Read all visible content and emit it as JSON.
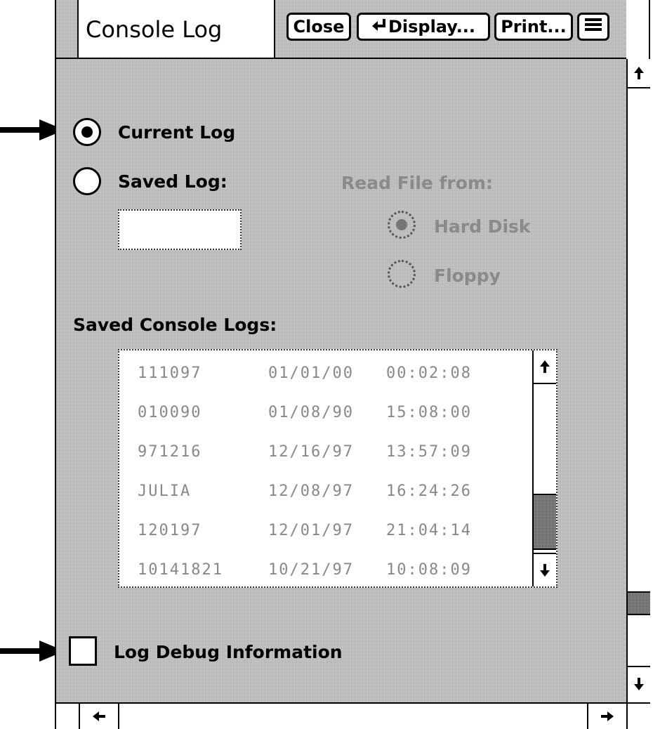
{
  "window": {
    "title": "Console Log",
    "buttons": {
      "close": "Close",
      "display": "Display...",
      "print": "Print..."
    }
  },
  "log_source": {
    "current_label": "Current Log",
    "current_selected": true,
    "saved_label": "Saved Log:",
    "saved_selected": false,
    "saved_name_value": ""
  },
  "read_from": {
    "label": "Read File from:",
    "options": [
      {
        "label": "Hard Disk",
        "selected": true
      },
      {
        "label": "Floppy",
        "selected": false
      }
    ]
  },
  "saved_logs": {
    "label": "Saved Console Logs:",
    "rows": [
      {
        "name": "111097",
        "date": "01/01/00",
        "time": "00:02:08"
      },
      {
        "name": "010090",
        "date": "01/08/90",
        "time": "15:08:00"
      },
      {
        "name": "971216",
        "date": "12/16/97",
        "time": "13:57:09"
      },
      {
        "name": "JULIA",
        "date": "12/08/97",
        "time": "16:24:26"
      },
      {
        "name": "120197",
        "date": "12/01/97",
        "time": "21:04:14"
      },
      {
        "name": "10141821",
        "date": "10/21/97",
        "time": "10:08:09"
      }
    ]
  },
  "debug": {
    "label": "Log Debug Information",
    "checked": false
  },
  "icons": {
    "menu": "hamburger-menu-icon",
    "display_prefix": "return-arrow-icon",
    "scroll_up": "arrow-up-icon",
    "scroll_down": "arrow-down-icon",
    "scroll_left": "arrow-left-icon",
    "scroll_right": "arrow-right-icon"
  }
}
